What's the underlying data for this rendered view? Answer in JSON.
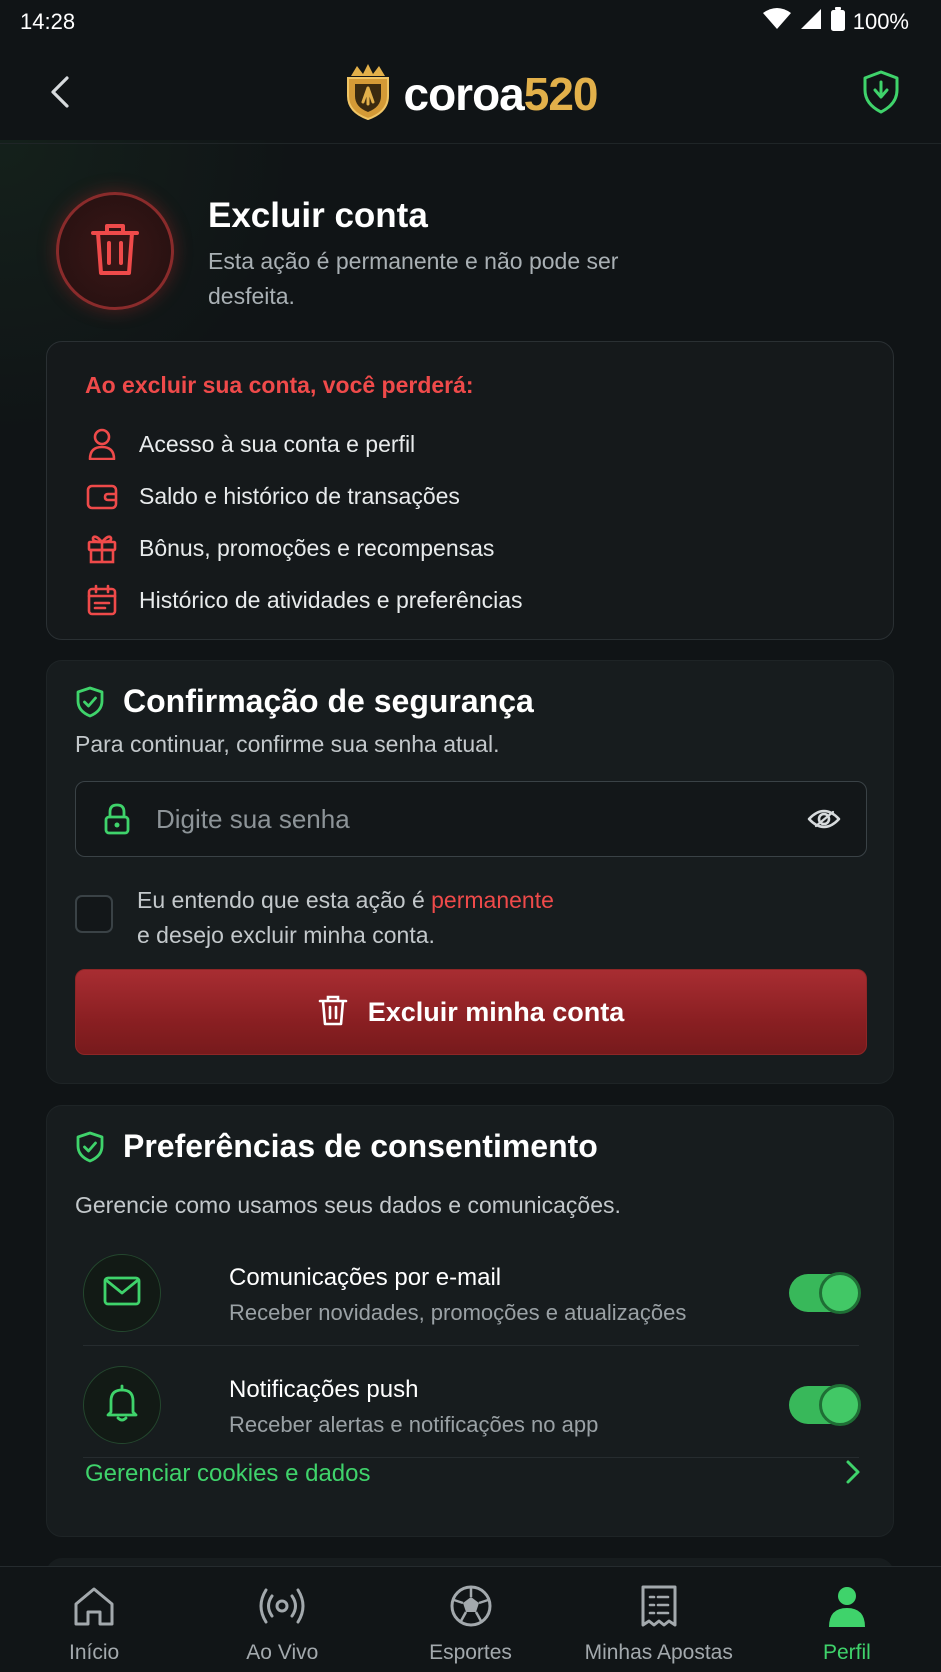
{
  "status_bar": {
    "time": "14:28",
    "battery": "100%"
  },
  "header": {
    "logo_part1": "coroa",
    "logo_part2": "520"
  },
  "hero": {
    "title": "Excluir conta",
    "subtitle": "Esta ação é permanente e não pode ser desfeita."
  },
  "loss": {
    "title": "Ao excluir sua conta, você perderá:",
    "items": [
      {
        "label": "Acesso à sua conta e perfil",
        "icon": "user-icon"
      },
      {
        "label": "Saldo e histórico de transações",
        "icon": "wallet-icon"
      },
      {
        "label": "Bônus, promoções e recompensas",
        "icon": "gift-icon"
      },
      {
        "label": "Histórico de atividades e preferências",
        "icon": "calendar-icon"
      }
    ]
  },
  "security": {
    "title": "Confirmação de segurança",
    "subtitle": "Para continuar, confirme sua senha atual.",
    "password_placeholder": "Digite sua senha",
    "password_value": "",
    "confirm_prefix": "Eu entendo que esta ação é ",
    "confirm_highlight": "permanente",
    "confirm_suffix": "e desejo excluir minha conta.",
    "confirm_checked": false,
    "delete_button": "Excluir minha conta"
  },
  "consent": {
    "title": "Preferências de consentimento",
    "subtitle": "Gerencie como usamos seus dados e comunicações.",
    "items": [
      {
        "title": "Comunicações por e-mail",
        "desc": "Receber novidades, promoções e atualizações",
        "enabled": true,
        "icon": "mail-icon"
      },
      {
        "title": "Notificações push",
        "desc": "Receber alertas e notificações no app",
        "enabled": true,
        "icon": "bell-icon"
      }
    ],
    "manage_link": "Gerenciar cookies e dados"
  },
  "nav": {
    "items": [
      {
        "label": "Início",
        "icon": "home-icon",
        "active": false
      },
      {
        "label": "Ao Vivo",
        "icon": "broadcast-icon",
        "active": false
      },
      {
        "label": "Esportes",
        "icon": "soccer-ball-icon",
        "active": false
      },
      {
        "label": "Minhas Apostas",
        "icon": "receipt-icon",
        "active": false
      },
      {
        "label": "Perfil",
        "icon": "person-icon",
        "active": true
      }
    ]
  },
  "colors": {
    "accent_green": "#3fd36b",
    "danger_red": "#ef4a4a",
    "brand_gold": "#e2b04a",
    "background": "#101416"
  }
}
